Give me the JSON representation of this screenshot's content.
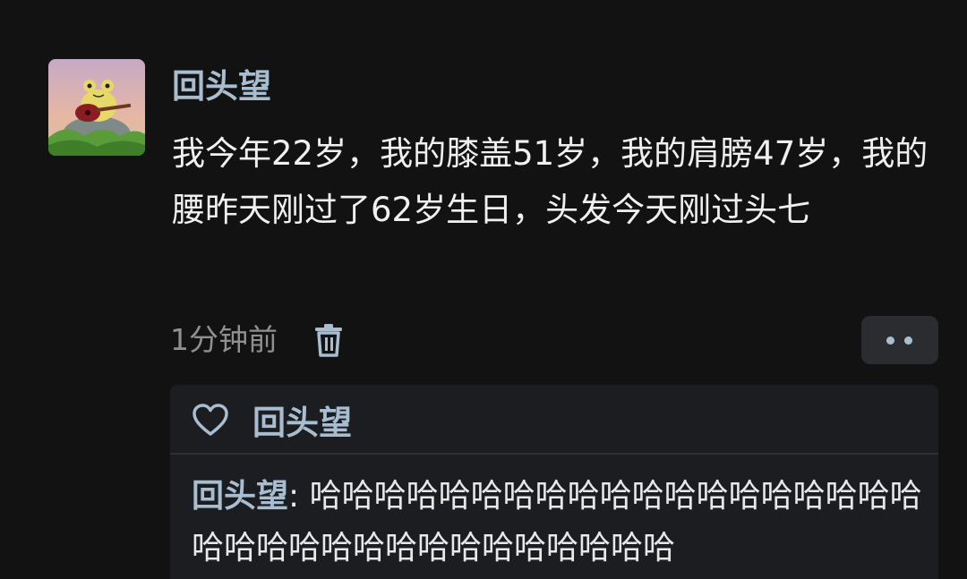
{
  "post": {
    "author": "回头望",
    "avatar_icon": "frog-guitar-avatar",
    "text": "我今年22岁，我的膝盖51岁，我的肩膀47岁，我的腰昨天刚过了62岁生日，头发今天刚过头七",
    "time": "1分钟前",
    "delete_icon": "trash-icon",
    "more_icon": "more-dots-icon"
  },
  "likes": {
    "icon": "heart-icon",
    "names": "回头望"
  },
  "reply": {
    "author": "回头望",
    "separator": ": ",
    "text": "哈哈哈哈哈哈哈哈哈哈哈哈哈哈哈哈哈哈哈哈哈哈哈哈哈哈哈哈哈哈哈哈哈哈"
  },
  "colors": {
    "background": "#121212",
    "accent_name": "#a9bdd1",
    "panel": "#1c1d20"
  }
}
